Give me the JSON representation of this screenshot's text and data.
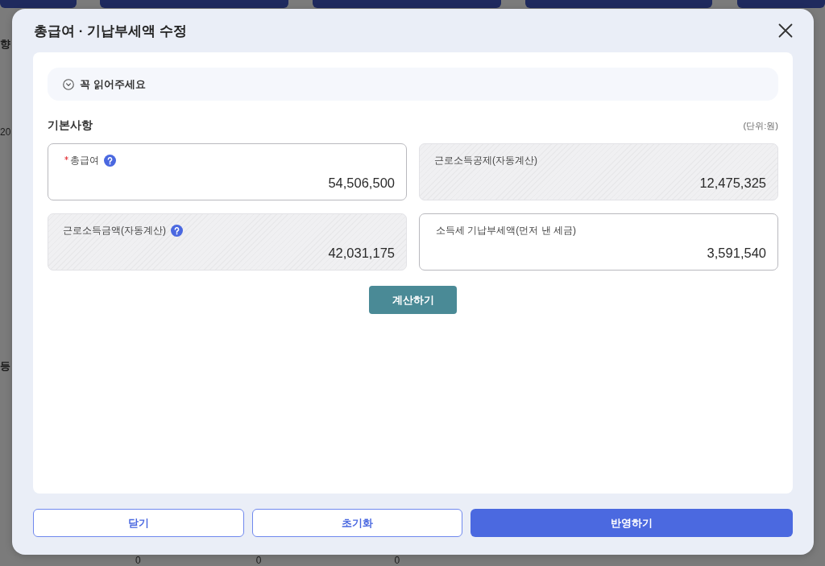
{
  "background_page": {
    "left_texts": [
      "향",
      "20",
      "등"
    ],
    "bottom_cells": [
      "0",
      "0",
      "0"
    ]
  },
  "dialog": {
    "title": "총급여 · 기납부세액 수정",
    "notice": {
      "text": "꼭 읽어주세요",
      "expanded": false
    },
    "section": {
      "title": "기본사항",
      "unit": "(단위:원)"
    },
    "fields": [
      {
        "label": "총급여",
        "value": "54,506,500",
        "required": true,
        "help": true,
        "readonly": false
      },
      {
        "label": "근로소득공제(자동계산)",
        "value": "12,475,325",
        "required": false,
        "help": false,
        "readonly": true
      },
      {
        "label": "근로소득금액(자동계산)",
        "value": "42,031,175",
        "required": false,
        "help": true,
        "readonly": true
      },
      {
        "label": "소득세 기납부세액(먼저 낸 세금)",
        "value": "3,591,540",
        "required": false,
        "help": false,
        "readonly": false
      }
    ],
    "calculate_button": "계산하기",
    "footer_buttons": [
      {
        "label": "닫기",
        "kind": "outline"
      },
      {
        "label": "초기화",
        "kind": "outline"
      },
      {
        "label": "반영하기",
        "kind": "primary"
      }
    ]
  }
}
